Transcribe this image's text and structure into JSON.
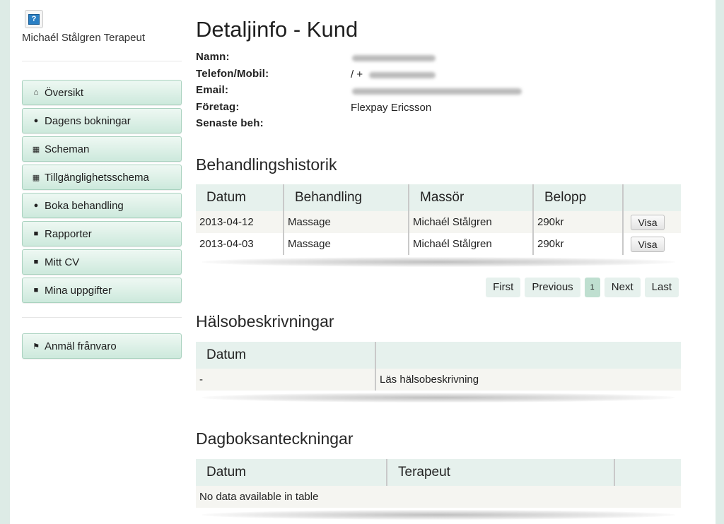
{
  "sidebar": {
    "therapist_name": "Michaél Stålgren Terapeut",
    "logo_glyph": "?",
    "nav": [
      {
        "label": "Översikt",
        "icon": "home-icon",
        "glyph": "⌂"
      },
      {
        "label": "Dagens bokningar",
        "icon": "drop-icon",
        "glyph": "●"
      },
      {
        "label": "Scheman",
        "icon": "calendar-icon",
        "glyph": "▦"
      },
      {
        "label": "Tillgänglighetsschema",
        "icon": "calendar-icon",
        "glyph": "▦"
      },
      {
        "label": "Boka behandling",
        "icon": "user-icon",
        "glyph": "●"
      },
      {
        "label": "Rapporter",
        "icon": "book-icon",
        "glyph": "■"
      },
      {
        "label": "Mitt CV",
        "icon": "folder-icon",
        "glyph": "■"
      },
      {
        "label": "Mina uppgifter",
        "icon": "folder-icon",
        "glyph": "■"
      }
    ],
    "absence": {
      "label": "Anmäl frånvaro",
      "icon": "flag-icon",
      "glyph": "⚑"
    }
  },
  "customer": {
    "title": "Detaljinfo - Kund",
    "fields": {
      "name_label": "Namn:",
      "phone_label": "Telefon/Mobil:",
      "phone_prefix": "/ +",
      "email_label": "Email:",
      "company_label": "Företag:",
      "company_value": "Flexpay Ericsson",
      "last_label": "Senaste beh:"
    }
  },
  "history": {
    "title": "Behandlingshistorik",
    "columns": [
      "Datum",
      "Behandling",
      "Massör",
      "Belopp",
      ""
    ],
    "rows": [
      {
        "date": "2013-04-12",
        "treatment": "Massage",
        "masseur": "Michaél Stålgren",
        "amount": "290kr",
        "action": "Visa"
      },
      {
        "date": "2013-04-03",
        "treatment": "Massage",
        "masseur": "Michaél Stålgren",
        "amount": "290kr",
        "action": "Visa"
      }
    ],
    "pager": {
      "first": "First",
      "previous": "Previous",
      "current": "1",
      "next": "Next",
      "last": "Last"
    }
  },
  "health": {
    "title": "Hälsobeskrivningar",
    "columns": [
      "Datum",
      ""
    ],
    "rows": [
      {
        "date": "-",
        "link": "Läs hälsobeskrivning"
      }
    ]
  },
  "diary": {
    "title": "Dagboksanteckningar",
    "columns": [
      "Datum",
      "Terapeut",
      ""
    ],
    "empty": "No data available in table"
  },
  "colors": {
    "accent": "#b92a2a",
    "nav_bg": "#cde9dc",
    "header_bg": "#e6f1ed"
  }
}
